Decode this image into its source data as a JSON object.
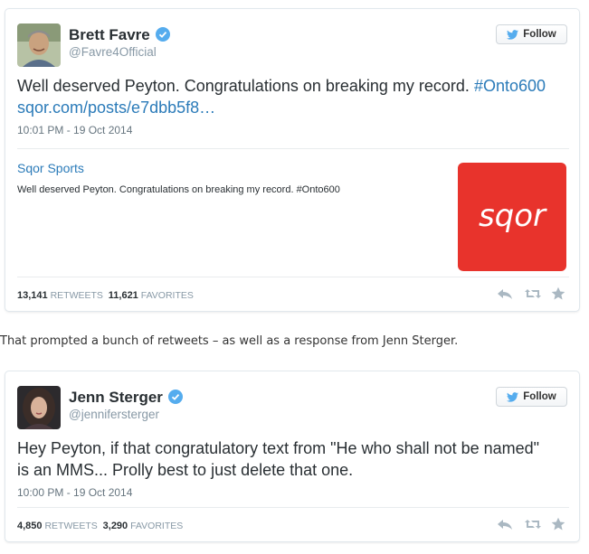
{
  "tweets": [
    {
      "name": "Brett Favre",
      "handle": "@Favre4Official",
      "follow_label": "Follow",
      "text": "Well deserved Peyton. Congratulations on breaking my record.",
      "hashtag": "#Onto600",
      "link": "sqor.com/posts/e7dbb5f8…",
      "timestamp": "10:01 PM - 19 Oct 2014",
      "card": {
        "title": "Sqor Sports",
        "description": "Well deserved Peyton. Congratulations on breaking my record. #Onto600",
        "logo_text": "sqor",
        "logo_color": "#e8332c"
      },
      "retweets": "13,141",
      "retweets_label": "RETWEETS",
      "favorites": "11,621",
      "favorites_label": "FAVORITES"
    },
    {
      "name": "Jenn Sterger",
      "handle": "@jennifersterger",
      "follow_label": "Follow",
      "text_line1": "Hey Peyton, if that congratulatory text from \"He who shall not be named\"",
      "text_line2": "is an MMS... Prolly best to just delete that one.",
      "timestamp": "10:00 PM - 19 Oct 2014",
      "retweets": "4,850",
      "retweets_label": "RETWEETS",
      "favorites": "3,290",
      "favorites_label": "FAVORITES"
    }
  ],
  "between_text": "That prompted a bunch of retweets – as well as a response from Jenn Sterger.",
  "colors": {
    "link": "#2b7bb9",
    "verified": "#55acee",
    "twitter_bird": "#55acee"
  },
  "icons": [
    "verified-icon",
    "twitter-bird-icon",
    "reply-icon",
    "retweet-icon",
    "favorite-icon"
  ]
}
